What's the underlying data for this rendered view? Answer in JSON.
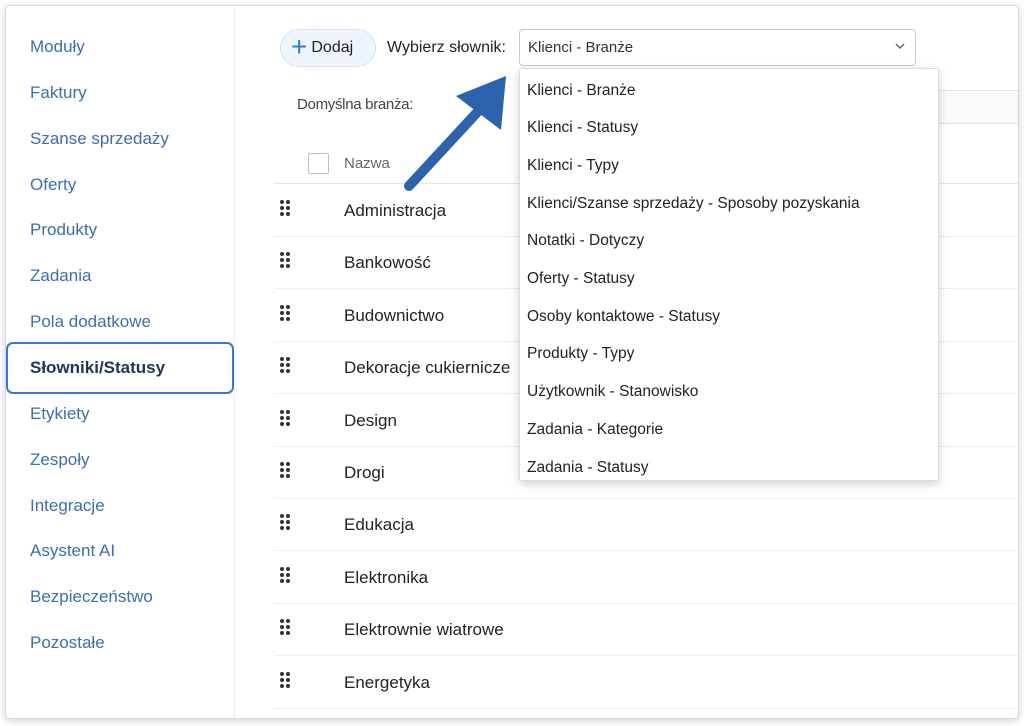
{
  "sidebar": {
    "items": [
      {
        "label": "Moduły"
      },
      {
        "label": "Faktury"
      },
      {
        "label": "Szanse sprzedaży"
      },
      {
        "label": "Oferty"
      },
      {
        "label": "Produkty"
      },
      {
        "label": "Zadania"
      },
      {
        "label": "Pola dodatkowe"
      },
      {
        "label": "Słowniki/Statusy",
        "active": true
      },
      {
        "label": "Etykiety"
      },
      {
        "label": "Zespoły"
      },
      {
        "label": "Integracje"
      },
      {
        "label": "Asystent AI"
      },
      {
        "label": "Bezpieczeństwo"
      },
      {
        "label": "Pozostałe"
      }
    ]
  },
  "toolbar": {
    "add_label": "Dodaj",
    "add_icon": "plus-icon",
    "dictionary_label": "Wybierz słownik:",
    "dictionary_selected": "Klienci - Branże"
  },
  "default_label": "Domyślna branża:",
  "table": {
    "column_name": "Nazwa",
    "rows": [
      "Administracja",
      "Bankowość",
      "Budownictwo",
      "Dekoracje cukiernicze",
      "Design",
      "Drogi",
      "Edukacja",
      "Elektronika",
      "Elektrownie wiatrowe",
      "Energetyka"
    ]
  },
  "dropdown": {
    "options": [
      "Klienci - Branże",
      "Klienci - Statusy",
      "Klienci - Typy",
      "Klienci/Szanse sprzedaży - Sposoby pozyskania",
      "Notatki - Dotyczy",
      "Oferty - Statusy",
      "Osoby kontaktowe - Statusy",
      "Produkty - Typy",
      "Użytkownik - Stanowisko",
      "Zadania - Kategorie",
      "Zadania - Statusy"
    ]
  },
  "colors": {
    "accent": "#2f7ad8",
    "sidebar_link": "#3a6fb0",
    "annotation_arrow": "#2f62ad"
  }
}
